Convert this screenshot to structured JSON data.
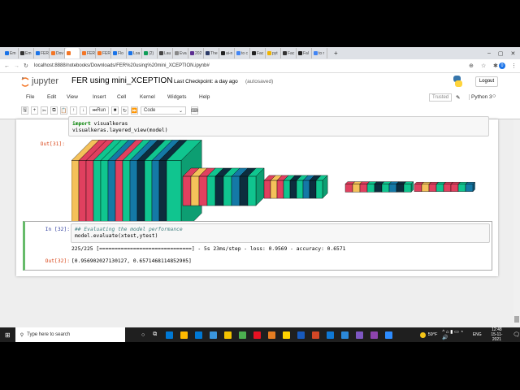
{
  "browser": {
    "tabs": [
      {
        "label": "Em",
        "color": "#1a73e8"
      },
      {
        "label": "Em",
        "color": "#333"
      },
      {
        "label": "FER",
        "color": "#1a73e8"
      },
      {
        "label": "Dov",
        "color": "#f37626"
      },
      {
        "label": "",
        "color": "#f37626",
        "active": true
      },
      {
        "label": "FER",
        "color": "#f37626"
      },
      {
        "label": "FER",
        "color": "#f37626"
      },
      {
        "label": "Flo",
        "color": "#1a73e8"
      },
      {
        "label": "Loa",
        "color": "#1a73e8"
      },
      {
        "label": "(2)",
        "color": "#0f9d58"
      },
      {
        "label": "Lau",
        "color": "#444"
      },
      {
        "label": "Eva",
        "color": "#888"
      },
      {
        "label": "202",
        "color": "#5c2d91"
      },
      {
        "label": "The",
        "color": "#2b3a67"
      },
      {
        "label": "ai-n",
        "color": "#222"
      },
      {
        "label": "to c",
        "color": "#4285f4"
      },
      {
        "label": "Fac",
        "color": "#222"
      },
      {
        "label": "pyt",
        "color": "#f0b400"
      },
      {
        "label": "Fac",
        "color": "#333"
      },
      {
        "label": "Fal",
        "color": "#222"
      },
      {
        "label": "to r",
        "color": "#4285f4"
      }
    ],
    "new_tab": "+",
    "url": "localhost:8888/notebooks/Downloads/FER%20using%20mini_XCEPTION.ipynb#",
    "profile_initial": "0"
  },
  "jupyter": {
    "logo_text": "jupyter",
    "notebook_title": "FER using mini_XCEPTION",
    "checkpoint": "Last Checkpoint: a day ago",
    "autosaved": "(autosaved)",
    "logout": "Logout",
    "menu": [
      "File",
      "Edit",
      "View",
      "Insert",
      "Cell",
      "Kernel",
      "Widgets",
      "Help"
    ],
    "trusted": "Trusted",
    "kernel": "Python 3",
    "run_label": "Run",
    "cell_type": "Code"
  },
  "cells": [
    {
      "code": [
        "import visualkeras",
        "visualkeras.layered_view(model)"
      ],
      "out_prompt": "Out[31]:"
    },
    {
      "in_prompt": "In [32]:",
      "code": [
        "## Evaluating the model performance",
        "model.evaluate(xtest,ytest)"
      ],
      "stream": "225/225 [==============================] - 5s 23ms/step - loss: 0.9569 - accuracy: 0.6571",
      "out_prompt": "Out[32]:",
      "result": "[0.956902027130127, 0.6571468114852905]"
    }
  ],
  "taskbar": {
    "search_placeholder": "Type here to search",
    "weather": "59°F",
    "lang": "ENG",
    "time": "12:48",
    "date": "15-11-2021"
  }
}
